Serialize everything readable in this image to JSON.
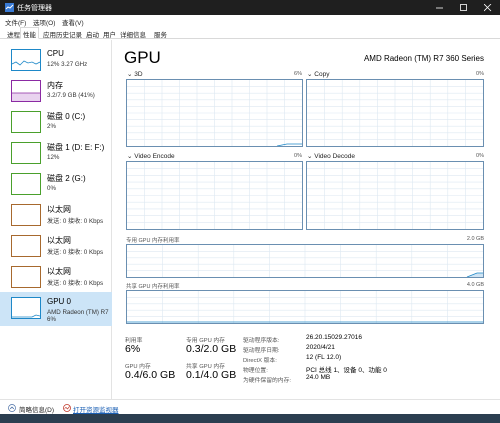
{
  "window": {
    "title": "任务管理器"
  },
  "menu": [
    "文件(F)",
    "选项(O)",
    "查看(V)"
  ],
  "tabs": [
    "进程",
    "性能",
    "应用历史记录",
    "启动",
    "用户",
    "详细信息",
    "服务"
  ],
  "active_tab": "性能",
  "sidebar": {
    "items": [
      {
        "name": "CPU",
        "sub": "12% 3.27 GHz",
        "color": "#1e88c8"
      },
      {
        "name": "内存",
        "sub": "3.2/7.9 GB (41%)",
        "color": "#8b2aa3"
      },
      {
        "name": "磁盘 0 (C:)",
        "sub": "2%",
        "color": "#4aa02c"
      },
      {
        "name": "磁盘 1 (D: E: F:)",
        "sub": "12%",
        "color": "#4aa02c"
      },
      {
        "name": "磁盘 2 (G:)",
        "sub": "0%",
        "color": "#4aa02c"
      },
      {
        "name": "以太网",
        "sub": "发送: 0 接收: 0 Kbps",
        "color": "#a7692e"
      },
      {
        "name": "以太网",
        "sub": "发送: 0 接收: 0 Kbps",
        "color": "#a7692e"
      },
      {
        "name": "以太网",
        "sub": "发送: 0 接收: 0 Kbps",
        "color": "#a7692e"
      },
      {
        "name": "GPU 0",
        "sub": "AMD Radeon (TM) R7",
        "sub2": "6%",
        "color": "#1e88c8"
      }
    ]
  },
  "main": {
    "title": "GPU",
    "model": "AMD Radeon (TM) R7 360 Series",
    "engines": [
      {
        "label": "3D",
        "pct": "6%"
      },
      {
        "label": "Copy",
        "pct": "0%"
      },
      {
        "label": "Video Encode",
        "pct": "0%"
      },
      {
        "label": "Video Decode",
        "pct": "0%"
      }
    ],
    "dedicated_mem": {
      "label": "专用 GPU 内存利用率",
      "max": "2.0 GB"
    },
    "shared_mem": {
      "label": "共享 GPU 内存利用率",
      "max": "4.0 GB"
    },
    "stats": {
      "util_label": "利用率",
      "util_value": "6%",
      "ded_label": "专用 GPU 内存",
      "ded_value": "0.3/2.0 GB",
      "gpu_mem_label": "GPU 内存",
      "gpu_mem_value": "0.4/6.0 GB",
      "shared_label": "共享 GPU 内存",
      "shared_value": "0.1/4.0 GB"
    },
    "info": [
      {
        "key": "驱动程序版本:",
        "value": "26.20.15029.27016"
      },
      {
        "key": "驱动程序日期:",
        "value": "2020/4/21"
      },
      {
        "key": "DirectX 版本:",
        "value": "12 (FL 12.0)"
      },
      {
        "key": "物理位置:",
        "value": "PCI 总线 1、设备 0、功能 0"
      },
      {
        "key": "为硬件保留的内存:",
        "value": "24.0 MB"
      }
    ]
  },
  "footer": {
    "less_details": "简略信息(D)",
    "open_monitor": "打开资源监视器"
  }
}
